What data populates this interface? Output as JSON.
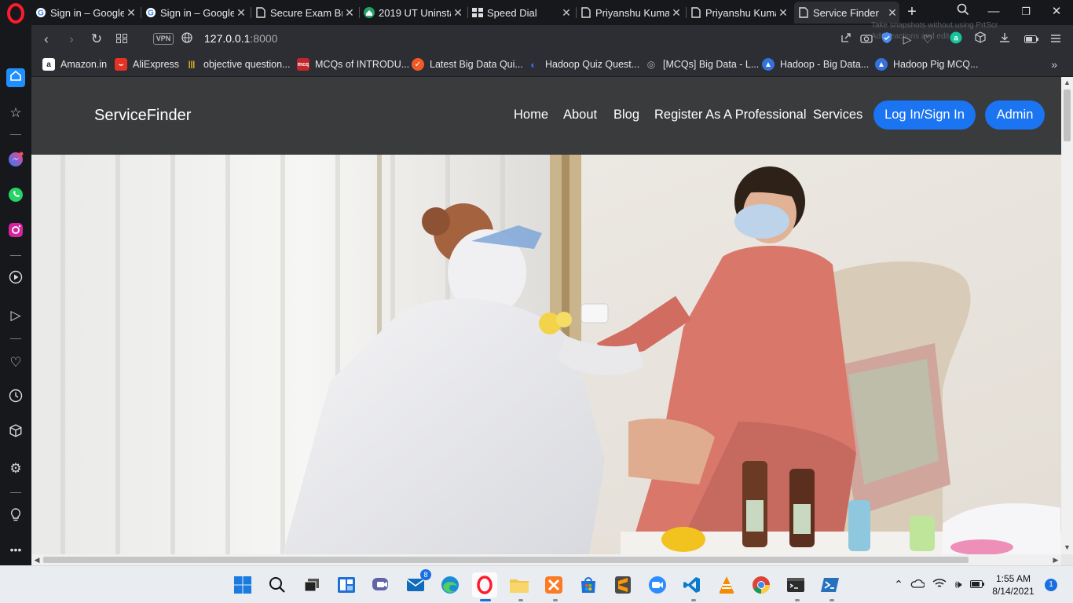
{
  "browser": {
    "tabs": [
      {
        "title": "Sign in – Google",
        "favicon": "google-g-icon"
      },
      {
        "title": "Sign in – Google",
        "favicon": "google-g-icon"
      },
      {
        "title": "Secure Exam Bro",
        "favicon": "page-icon"
      },
      {
        "title": "2019 UT Uninsta",
        "favicon": "green-house-icon"
      },
      {
        "title": "Speed Dial",
        "favicon": "grid-icon"
      },
      {
        "title": "Priyanshu Kuma",
        "favicon": "page-icon"
      },
      {
        "title": "Priyanshu Kuma",
        "favicon": "page-icon"
      },
      {
        "title": "Service Finder",
        "favicon": "page-icon",
        "active": true
      }
    ],
    "new_tab": "+",
    "address": {
      "host": "127.0.0.1",
      "port": ":8000"
    },
    "vpn_label": "VPN",
    "ghost_tip": {
      "line1": "Take snapshots without using PrtScr",
      "line2": "Add reactions and edit"
    },
    "bookmarks": [
      {
        "label": "Amazon.in",
        "icon": "amazon-icon",
        "color": "#ffffff"
      },
      {
        "label": "AliExpress",
        "icon": "aliexpress-icon",
        "color": "#e43225"
      },
      {
        "label": "objective question...",
        "icon": "books-icon",
        "color": "#f3c623"
      },
      {
        "label": "MCQs of INTRODU...",
        "icon": "mcq-icon",
        "color": "#c0262c"
      },
      {
        "label": "Latest Big Data Qui...",
        "icon": "quiz-icon",
        "color": "#f05a28"
      },
      {
        "label": "Hadoop Quiz Quest...",
        "icon": "blue-swirl-icon",
        "color": "#2f6fdd"
      },
      {
        "label": "[MCQs] Big Data - L...",
        "icon": "circle-icon",
        "color": "#b0b0b0"
      },
      {
        "label": "Hadoop - Big Data...",
        "icon": "cap-icon",
        "color": "#3572d9"
      },
      {
        "label": "Hadoop Pig MCQ...",
        "icon": "cap-icon",
        "color": "#3572d9"
      }
    ],
    "more_bookmarks": "»"
  },
  "site": {
    "brand": "ServiceFinder",
    "nav": [
      "Home",
      "About",
      "Blog",
      "Register As A Professional",
      "Services"
    ],
    "login_button": "Log In/Sign In",
    "admin_button": "Admin",
    "accent": "#1b74f2",
    "navbar_bg": "#3a3b3d"
  },
  "taskbar": {
    "time": "1:55 AM",
    "date": "8/14/2021",
    "mail_badge": "8",
    "notification_count": "1"
  }
}
